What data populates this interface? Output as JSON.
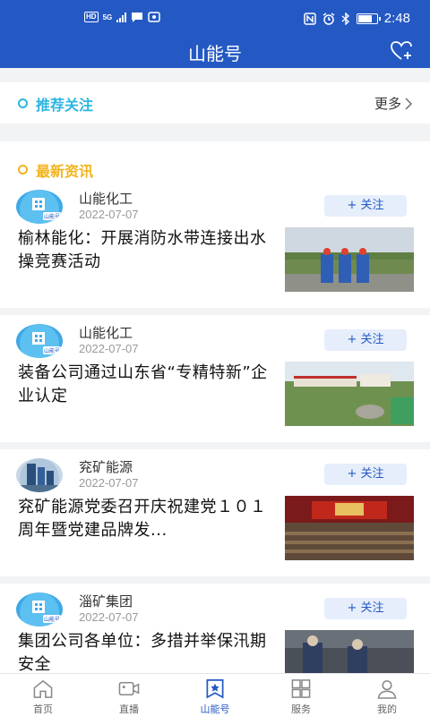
{
  "status_bar": {
    "hd": "HD",
    "net": "5G",
    "time": "2:48",
    "battery_level": 0.7
  },
  "nav": {
    "title": "山能号",
    "action_icon": "heart-plus-icon"
  },
  "recommend": {
    "title": "推荐关注",
    "more_label": "更多"
  },
  "news": {
    "title": "最新资讯",
    "items": [
      {
        "source": "山能化工",
        "date": "2022-07-07",
        "follow_label": "+ 关注",
        "title": "榆林能化：开展消防水带连接出水操竞赛活动"
      },
      {
        "source": "山能化工",
        "date": "2022-07-07",
        "follow_label": "+ 关注",
        "title": "装备公司通过山东省“专精特新”企业认定"
      },
      {
        "source": "兖矿能源",
        "date": "2022-07-07",
        "follow_label": "+ 关注",
        "title": "兖矿能源党委召开庆祝建党１０１周年暨党建品牌发..."
      },
      {
        "source": "淄矿集团",
        "date": "2022-07-07",
        "follow_label": "+ 关注",
        "title": "集团公司各单位：多措并举保汛期安全"
      }
    ]
  },
  "tabs": [
    {
      "label": "首页",
      "icon": "home-icon"
    },
    {
      "label": "直播",
      "icon": "video-camera-icon"
    },
    {
      "label": "山能号",
      "icon": "bookmark-star-icon",
      "active": true
    },
    {
      "label": "服务",
      "icon": "grid-icon"
    },
    {
      "label": "我的",
      "icon": "person-icon"
    }
  ],
  "colors": {
    "brand_blue": "#2459c4",
    "recommend_accent": "#2cb6e0",
    "news_accent": "#f2b41e"
  },
  "avatar_badges": {
    "shanneng": "山能号"
  }
}
